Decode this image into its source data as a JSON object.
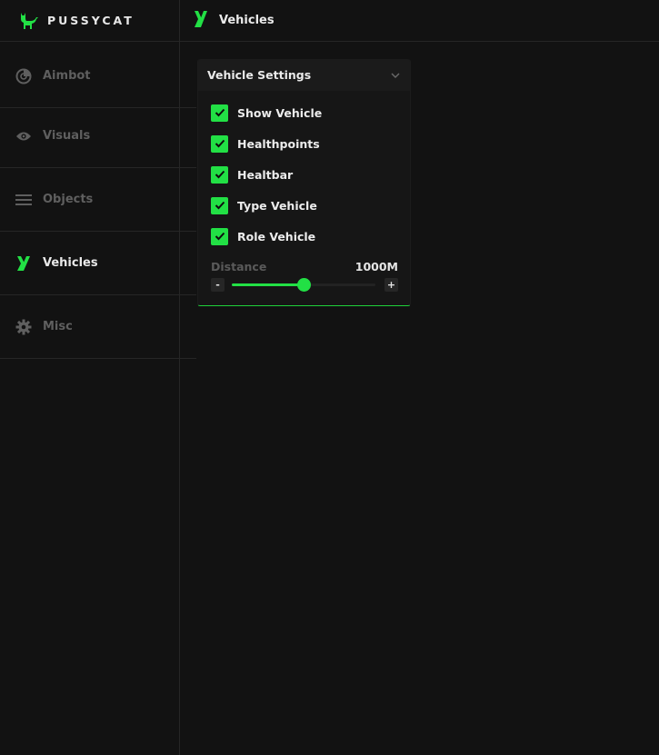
{
  "brand": {
    "name": "PUSSYCAT",
    "icon": "cat-icon"
  },
  "sidebar": {
    "items": [
      {
        "label": "Aimbot",
        "icon": "aimbot-icon",
        "active": false
      },
      {
        "label": "Visuals",
        "icon": "eye-icon",
        "active": false
      },
      {
        "label": "Objects",
        "icon": "menu-lines-icon",
        "active": false
      },
      {
        "label": "Vehicles",
        "icon": "vehicles-icon",
        "active": true
      },
      {
        "label": "Misc",
        "icon": "gear-icon",
        "active": false
      }
    ]
  },
  "header": {
    "title": "Vehicles",
    "icon": "vehicles-icon"
  },
  "panel": {
    "title": "Vehicle Settings",
    "options": [
      {
        "label": "Show Vehicle",
        "checked": true
      },
      {
        "label": "Healthpoints",
        "checked": true
      },
      {
        "label": "Healtbar",
        "checked": true
      },
      {
        "label": "Type Vehicle",
        "checked": true
      },
      {
        "label": "Role Vehicle",
        "checked": true
      }
    ],
    "distance": {
      "label": "Distance",
      "value_text": "1000M",
      "fraction": 0.5,
      "minus_label": "-",
      "plus_label": "+"
    }
  },
  "colors": {
    "accent": "#22e045",
    "background": "#121212",
    "panel": "#161616",
    "inactive_text": "#5f5f5f"
  }
}
